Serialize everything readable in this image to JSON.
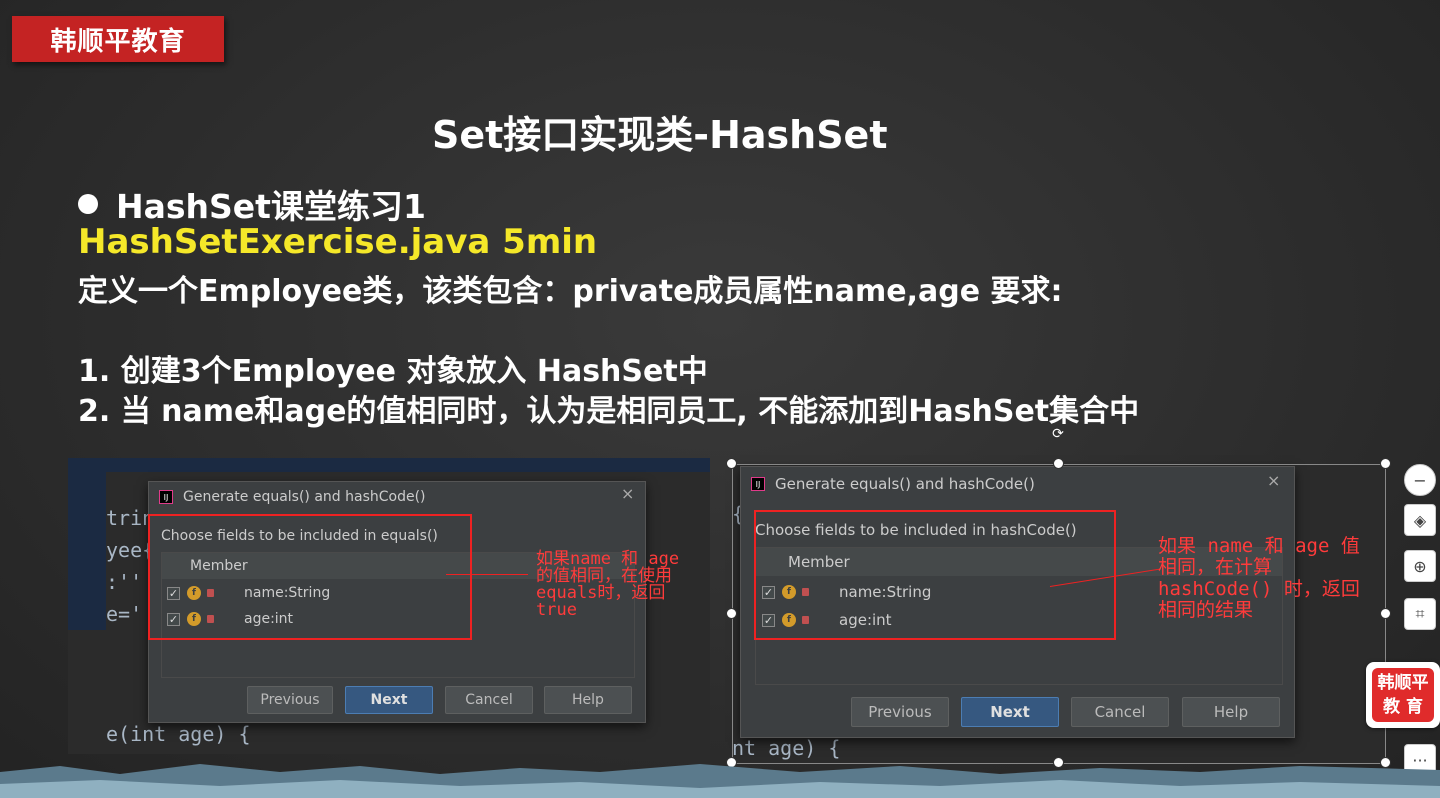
{
  "logo": {
    "text": "韩顺平教育"
  },
  "slide": {
    "title": "Set接口实现类-HashSet",
    "bullet": "HashSet课堂练习1",
    "file_line": "HashSetExercise.java 5min",
    "description": "定义一个Employee类，该类包含：private成员属性name,age 要求:",
    "req1": "1. 创建3个Employee 对象放入 HashSet中",
    "req2": "2. 当 name和age的值相同时，认为是相同员工, 不能添加到HashSet集合中"
  },
  "left_code": {
    "l1": "tring",
    "l2": "yee{",
    "l3": ":'' +",
    "l4": "e=' +",
    "l5": "e(int age) {"
  },
  "left_dialog": {
    "title": "Generate equals() and hashCode()",
    "close": "×",
    "subtitle": "Choose fields to be included in equals()",
    "column": "Member",
    "rows": [
      {
        "check": "✓",
        "icon": "f",
        "label": "name:String"
      },
      {
        "check": "✓",
        "icon": "f",
        "label": "age:int"
      }
    ],
    "buttons": {
      "previous": "Previous",
      "next": "Next",
      "cancel": "Cancel",
      "help": "Help"
    }
  },
  "left_note": {
    "l1": "如果name 和 age",
    "l2": "的值相同，在使用",
    "l3": "equals时，返回",
    "l4": "true"
  },
  "right_code": {
    "l1": "{",
    "l2": "nt age) {"
  },
  "right_dialog": {
    "title": "Generate equals() and hashCode()",
    "close": "×",
    "subtitle": "Choose fields to be included in hashCode()",
    "column": "Member",
    "rows": [
      {
        "check": "✓",
        "icon": "f",
        "label": "name:String"
      },
      {
        "check": "✓",
        "icon": "f",
        "label": "age:int"
      }
    ],
    "buttons": {
      "previous": "Previous",
      "next": "Next",
      "cancel": "Cancel",
      "help": "Help"
    }
  },
  "right_note": {
    "l1": "如果 name 和 age 值",
    "l2": "相同，在计算",
    "l3": "hashCode() 时，返回",
    "l4": "相同的结果"
  },
  "toolbar": {
    "zoom_out": "−",
    "layers": "◈",
    "zoom_in": "⊕",
    "crop": "⌗",
    "more": "···"
  },
  "badge": {
    "line1": "韩顺平",
    "line2": "教 育"
  },
  "colors": {
    "logo_red": "#c42323",
    "highlight_yellow": "#f5e829",
    "annotation_red": "#ff3b3b",
    "dialog_bg": "#3c3f41",
    "primary_button": "#365880"
  }
}
